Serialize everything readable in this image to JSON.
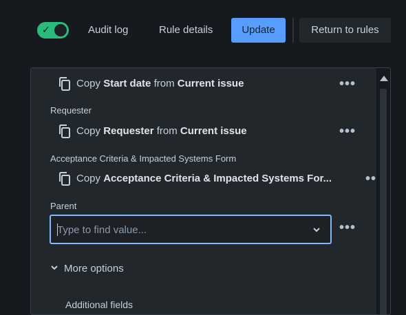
{
  "toolbar": {
    "toggle_on": true,
    "audit_log": "Audit log",
    "rule_details": "Rule details",
    "update": "Update",
    "return_to_rules": "Return to rules"
  },
  "fields": [
    {
      "label": "",
      "copy_prefix": "Copy",
      "field": "Start date",
      "from_word": "from",
      "source": "Current issue"
    },
    {
      "label": "Requester",
      "copy_prefix": "Copy",
      "field": "Requester",
      "from_word": "from",
      "source": "Current issue"
    },
    {
      "label": "Acceptance Criteria & Impacted Systems Form",
      "copy_prefix": "Copy",
      "field": "Acceptance Criteria & Impacted Systems For...",
      "from_word": "",
      "source": ""
    }
  ],
  "parent": {
    "label": "Parent",
    "placeholder": "Type to find value..."
  },
  "more_options": "More options",
  "additional_fields": "Additional fields",
  "colors": {
    "background": "#16191d",
    "panel": "#22272b",
    "accent": "#579dff",
    "toggle": "#2abb7f",
    "focus_border": "#85b8ff"
  },
  "icons": [
    "check-icon",
    "copy-icon",
    "more-icon",
    "chevron-down-icon",
    "scroll-up-icon"
  ]
}
